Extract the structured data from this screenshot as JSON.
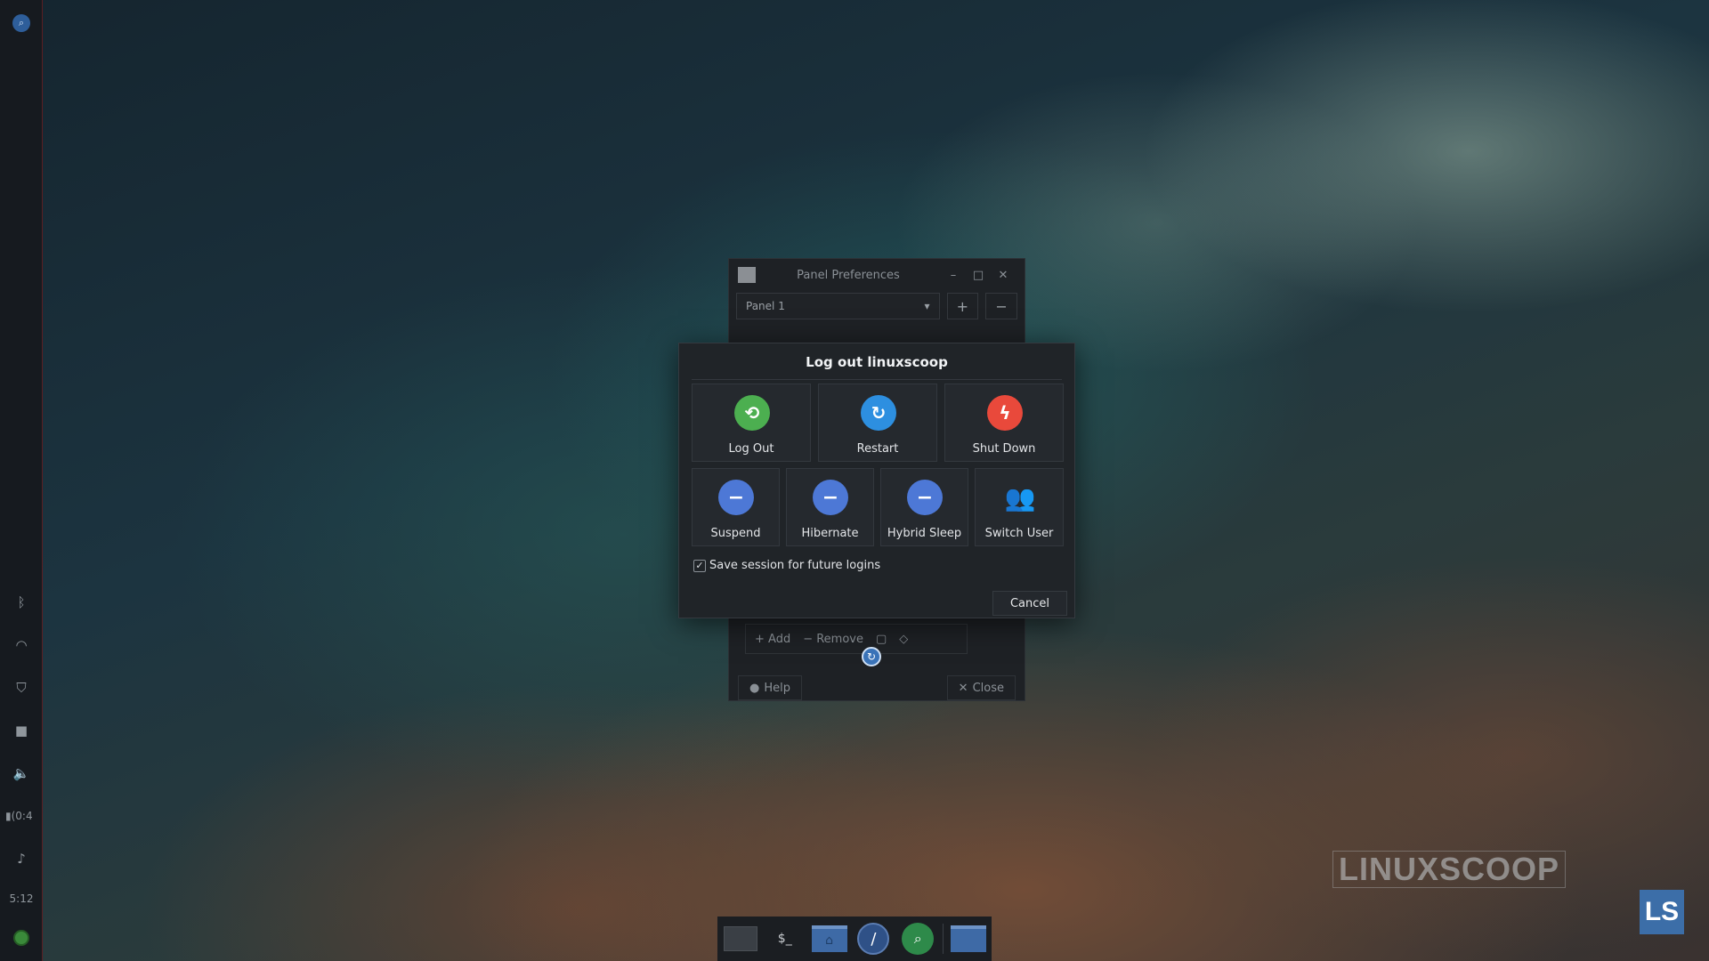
{
  "side_panel": {
    "battery_text": "(0:4",
    "clock": "5:12"
  },
  "prefs_window": {
    "title": "Panel Preferences",
    "panel_select_value": "Panel 1",
    "add_item_label": "Add",
    "remove_item_label": "Remove",
    "help_label": "Help",
    "close_label": "Close"
  },
  "logout_dialog": {
    "title": "Log out linuxscoop",
    "actions_top": [
      {
        "label": "Log Out",
        "icon": "log-out-icon",
        "color": "#4caf50"
      },
      {
        "label": "Restart",
        "icon": "restart-icon",
        "color": "#2d8fe0"
      },
      {
        "label": "Shut Down",
        "icon": "shut-down-icon",
        "color": "#e9493b"
      }
    ],
    "actions_bottom": [
      {
        "label": "Suspend",
        "icon": "suspend-icon",
        "color": "#4d78d6"
      },
      {
        "label": "Hibernate",
        "icon": "hibernate-icon",
        "color": "#4d78d6"
      },
      {
        "label": "Hybrid Sleep",
        "icon": "hybrid-sleep-icon",
        "color": "#4d78d6"
      },
      {
        "label": "Switch User",
        "icon": "switch-user-icon",
        "color": "#e0e0e0"
      }
    ],
    "save_session_label": "Save session for future logins",
    "save_session_checked": true,
    "cancel_label": "Cancel"
  },
  "dock": {
    "terminal_label": "$_"
  },
  "watermark": {
    "text": "LINUXSCOOP",
    "logo_text": "LS"
  }
}
